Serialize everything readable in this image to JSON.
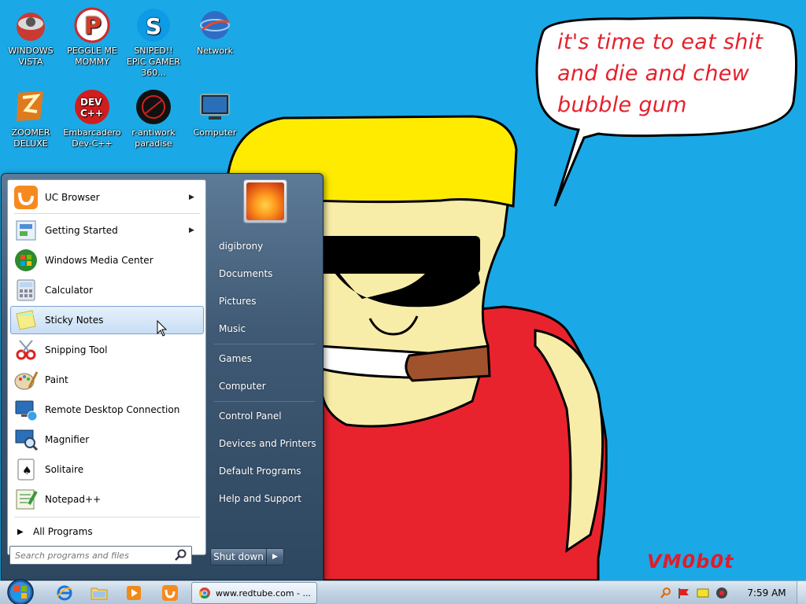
{
  "wallpaper": {
    "speech_bubble": "it's time to eat shit and die and chew bubble gum",
    "signature": "VM0b0t"
  },
  "desktop_icons": [
    {
      "id": "windows-vista",
      "label": "WINDOWS VISTA",
      "icon": "windows-vista-icon"
    },
    {
      "id": "peggle",
      "label": "PEGGLE ME MOMMY",
      "icon": "peggle-icon"
    },
    {
      "id": "sniped",
      "label": "SNIPED!! EPIC GAMER 360...",
      "icon": "skype-icon"
    },
    {
      "id": "network",
      "label": "Network",
      "icon": "network-icon"
    },
    {
      "id": "zoomer",
      "label": "ZOOMER DELUXE",
      "icon": "zoomer-icon"
    },
    {
      "id": "devcpp",
      "label": "Embarcadero Dev-C++",
      "icon": "devcpp-icon"
    },
    {
      "id": "antiwork",
      "label": "r-antiwork paradise",
      "icon": "antiwork-icon"
    },
    {
      "id": "computer",
      "label": "Computer",
      "icon": "computer-icon"
    }
  ],
  "start_menu": {
    "programs": [
      {
        "label": "UC Browser",
        "icon": "uc-browser-icon",
        "submenu": true
      },
      {
        "label": "Getting Started",
        "icon": "getting-started-icon",
        "submenu": true
      },
      {
        "label": "Windows Media Center",
        "icon": "media-center-icon",
        "submenu": false
      },
      {
        "label": "Calculator",
        "icon": "calculator-icon",
        "submenu": false
      },
      {
        "label": "Sticky Notes",
        "icon": "sticky-notes-icon",
        "submenu": false,
        "selected": true
      },
      {
        "label": "Snipping Tool",
        "icon": "snipping-tool-icon",
        "submenu": false
      },
      {
        "label": "Paint",
        "icon": "paint-icon",
        "submenu": false
      },
      {
        "label": "Remote Desktop Connection",
        "icon": "remote-desktop-icon",
        "submenu": false
      },
      {
        "label": "Magnifier",
        "icon": "magnifier-icon",
        "submenu": false
      },
      {
        "label": "Solitaire",
        "icon": "solitaire-icon",
        "submenu": false
      },
      {
        "label": "Notepad++",
        "icon": "notepadpp-icon",
        "submenu": false
      }
    ],
    "all_programs": "All Programs",
    "search_placeholder": "Search programs and files",
    "right_items": [
      {
        "label": "digibrony"
      },
      {
        "label": "Documents"
      },
      {
        "label": "Pictures"
      },
      {
        "label": "Music"
      },
      {
        "label": "Games"
      },
      {
        "label": "Computer"
      },
      {
        "label": "Control Panel"
      },
      {
        "label": "Devices and Printers"
      },
      {
        "label": "Default Programs"
      },
      {
        "label": "Help and Support"
      }
    ],
    "shutdown_label": "Shut down"
  },
  "taskbar": {
    "chrome_window_title": "www.redtube.com - ...",
    "clock": "7:59 AM"
  },
  "colors": {
    "desktop_bg": "#1aa9e6",
    "bubble_text": "#e5202c",
    "shirt": "#e8232d",
    "hair": "#ffeb00",
    "skin": "#f8eda8"
  }
}
